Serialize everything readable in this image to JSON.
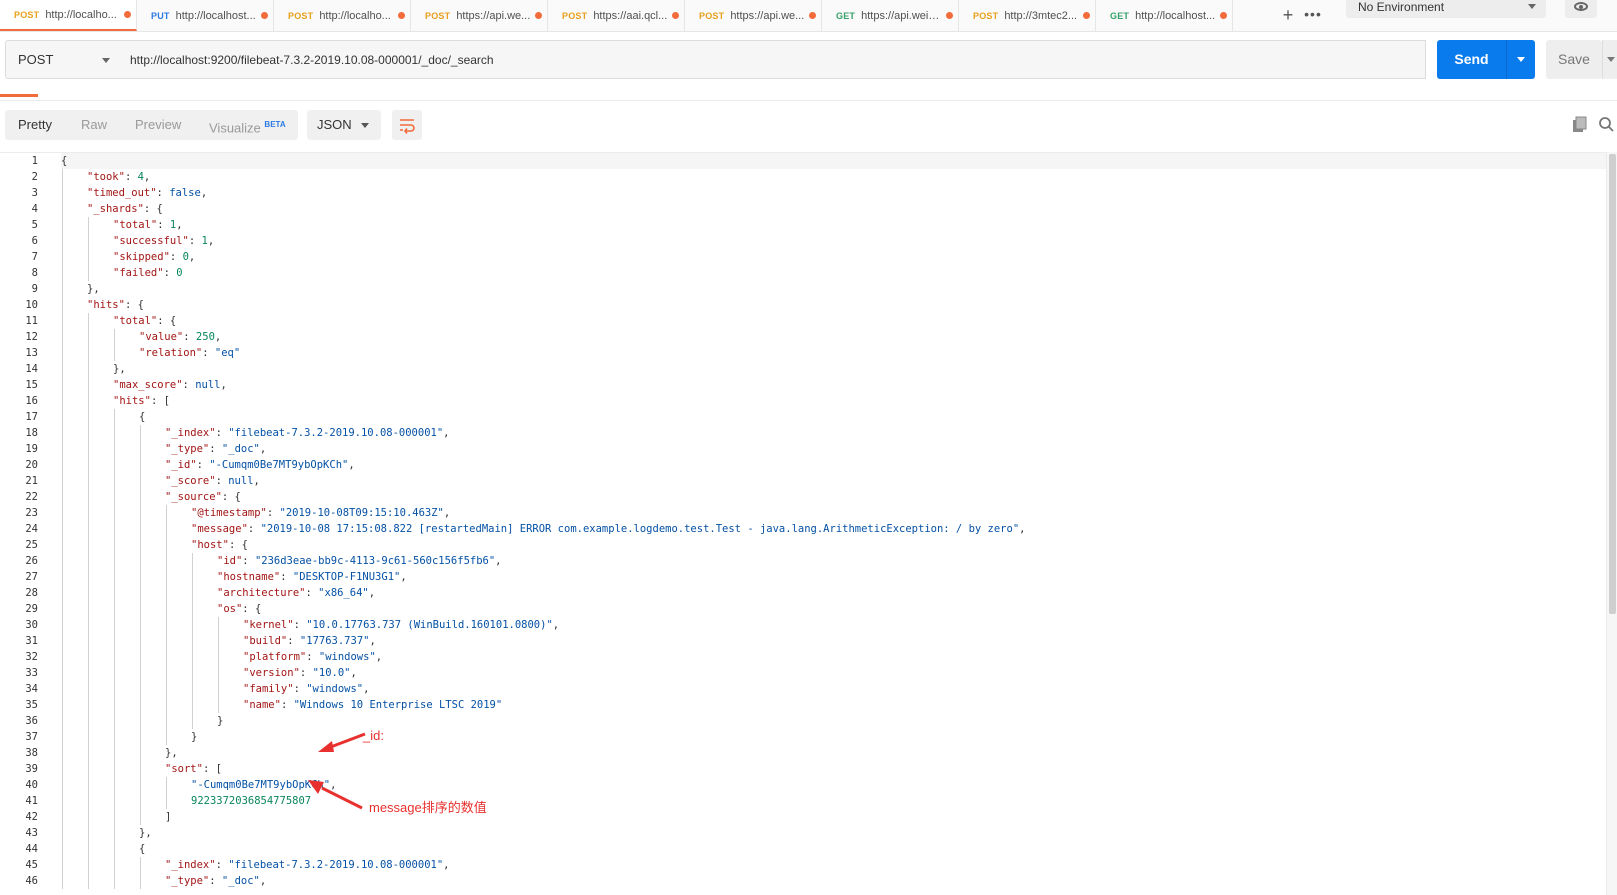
{
  "tabs": [
    {
      "method": "POST",
      "url": "http://localho..."
    },
    {
      "method": "PUT",
      "url": "http://localhost..."
    },
    {
      "method": "POST",
      "url": "http://localho..."
    },
    {
      "method": "POST",
      "url": "https://api.we..."
    },
    {
      "method": "POST",
      "url": "https://aai.qcl..."
    },
    {
      "method": "POST",
      "url": "https://api.we..."
    },
    {
      "method": "GET",
      "url": "https://api.weix..."
    },
    {
      "method": "POST",
      "url": "http://3mtec2..."
    },
    {
      "method": "GET",
      "url": "http://localhost..."
    }
  ],
  "environment": {
    "label": "No Environment"
  },
  "request": {
    "method": "POST",
    "url": "http://localhost:9200/filebeat-7.3.2-2019.10.08-000001/_doc/_search",
    "send_label": "Send",
    "save_label": "Save"
  },
  "response": {
    "view_tabs": [
      "Pretty",
      "Raw",
      "Preview",
      "Visualize"
    ],
    "beta_badge": "BETA",
    "format": "JSON"
  },
  "code_lines": [
    {
      "n": "1",
      "i": 0,
      "t": [
        [
          "p",
          "{"
        ]
      ]
    },
    {
      "n": "2",
      "i": 1,
      "t": [
        [
          "k",
          "\"took\""
        ],
        [
          "p",
          ": "
        ],
        [
          "n",
          "4"
        ],
        [
          "p",
          ","
        ]
      ]
    },
    {
      "n": "3",
      "i": 1,
      "t": [
        [
          "k",
          "\"timed_out\""
        ],
        [
          "p",
          ": "
        ],
        [
          "w",
          "false"
        ],
        [
          "p",
          ","
        ]
      ]
    },
    {
      "n": "4",
      "i": 1,
      "t": [
        [
          "k",
          "\"_shards\""
        ],
        [
          "p",
          ": {"
        ]
      ]
    },
    {
      "n": "5",
      "i": 2,
      "t": [
        [
          "k",
          "\"total\""
        ],
        [
          "p",
          ": "
        ],
        [
          "n",
          "1"
        ],
        [
          "p",
          ","
        ]
      ]
    },
    {
      "n": "6",
      "i": 2,
      "t": [
        [
          "k",
          "\"successful\""
        ],
        [
          "p",
          ": "
        ],
        [
          "n",
          "1"
        ],
        [
          "p",
          ","
        ]
      ]
    },
    {
      "n": "7",
      "i": 2,
      "t": [
        [
          "k",
          "\"skipped\""
        ],
        [
          "p",
          ": "
        ],
        [
          "n",
          "0"
        ],
        [
          "p",
          ","
        ]
      ]
    },
    {
      "n": "8",
      "i": 2,
      "t": [
        [
          "k",
          "\"failed\""
        ],
        [
          "p",
          ": "
        ],
        [
          "n",
          "0"
        ]
      ]
    },
    {
      "n": "9",
      "i": 1,
      "t": [
        [
          "p",
          "},"
        ]
      ]
    },
    {
      "n": "10",
      "i": 1,
      "t": [
        [
          "k",
          "\"hits\""
        ],
        [
          "p",
          ": {"
        ]
      ]
    },
    {
      "n": "11",
      "i": 2,
      "t": [
        [
          "k",
          "\"total\""
        ],
        [
          "p",
          ": {"
        ]
      ]
    },
    {
      "n": "12",
      "i": 3,
      "t": [
        [
          "k",
          "\"value\""
        ],
        [
          "p",
          ": "
        ],
        [
          "n",
          "250"
        ],
        [
          "p",
          ","
        ]
      ]
    },
    {
      "n": "13",
      "i": 3,
      "t": [
        [
          "k",
          "\"relation\""
        ],
        [
          "p",
          ": "
        ],
        [
          "s",
          "\"eq\""
        ]
      ]
    },
    {
      "n": "14",
      "i": 2,
      "t": [
        [
          "p",
          "},"
        ]
      ]
    },
    {
      "n": "15",
      "i": 2,
      "t": [
        [
          "k",
          "\"max_score\""
        ],
        [
          "p",
          ": "
        ],
        [
          "w",
          "null"
        ],
        [
          "p",
          ","
        ]
      ]
    },
    {
      "n": "16",
      "i": 2,
      "t": [
        [
          "k",
          "\"hits\""
        ],
        [
          "p",
          ": ["
        ]
      ]
    },
    {
      "n": "17",
      "i": 3,
      "t": [
        [
          "p",
          "{"
        ]
      ]
    },
    {
      "n": "18",
      "i": 4,
      "t": [
        [
          "k",
          "\"_index\""
        ],
        [
          "p",
          ": "
        ],
        [
          "s",
          "\"filebeat-7.3.2-2019.10.08-000001\""
        ],
        [
          "p",
          ","
        ]
      ]
    },
    {
      "n": "19",
      "i": 4,
      "t": [
        [
          "k",
          "\"_type\""
        ],
        [
          "p",
          ": "
        ],
        [
          "s",
          "\"_doc\""
        ],
        [
          "p",
          ","
        ]
      ]
    },
    {
      "n": "20",
      "i": 4,
      "t": [
        [
          "k",
          "\"_id\""
        ],
        [
          "p",
          ": "
        ],
        [
          "s",
          "\"-Cumqm0Be7MT9ybOpKCh\""
        ],
        [
          "p",
          ","
        ]
      ]
    },
    {
      "n": "21",
      "i": 4,
      "t": [
        [
          "k",
          "\"_score\""
        ],
        [
          "p",
          ": "
        ],
        [
          "w",
          "null"
        ],
        [
          "p",
          ","
        ]
      ]
    },
    {
      "n": "22",
      "i": 4,
      "t": [
        [
          "k",
          "\"_source\""
        ],
        [
          "p",
          ": {"
        ]
      ]
    },
    {
      "n": "23",
      "i": 5,
      "t": [
        [
          "k",
          "\"@timestamp\""
        ],
        [
          "p",
          ": "
        ],
        [
          "s",
          "\"2019-10-08T09:15:10.463Z\""
        ],
        [
          "p",
          ","
        ]
      ]
    },
    {
      "n": "24",
      "i": 5,
      "t": [
        [
          "k",
          "\"message\""
        ],
        [
          "p",
          ": "
        ],
        [
          "s",
          "\"2019-10-08 17:15:08.822 [restartedMain] ERROR com.example.logdemo.test.Test - java.lang.ArithmeticException: / by zero\""
        ],
        [
          "p",
          ","
        ]
      ]
    },
    {
      "n": "25",
      "i": 5,
      "t": [
        [
          "k",
          "\"host\""
        ],
        [
          "p",
          ": {"
        ]
      ]
    },
    {
      "n": "26",
      "i": 6,
      "t": [
        [
          "k",
          "\"id\""
        ],
        [
          "p",
          ": "
        ],
        [
          "s",
          "\"236d3eae-bb9c-4113-9c61-560c156f5fb6\""
        ],
        [
          "p",
          ","
        ]
      ]
    },
    {
      "n": "27",
      "i": 6,
      "t": [
        [
          "k",
          "\"hostname\""
        ],
        [
          "p",
          ": "
        ],
        [
          "s",
          "\"DESKTOP-F1NU3G1\""
        ],
        [
          "p",
          ","
        ]
      ]
    },
    {
      "n": "28",
      "i": 6,
      "t": [
        [
          "k",
          "\"architecture\""
        ],
        [
          "p",
          ": "
        ],
        [
          "s",
          "\"x86_64\""
        ],
        [
          "p",
          ","
        ]
      ]
    },
    {
      "n": "29",
      "i": 6,
      "t": [
        [
          "k",
          "\"os\""
        ],
        [
          "p",
          ": {"
        ]
      ]
    },
    {
      "n": "30",
      "i": 7,
      "t": [
        [
          "k",
          "\"kernel\""
        ],
        [
          "p",
          ": "
        ],
        [
          "s",
          "\"10.0.17763.737 (WinBuild.160101.0800)\""
        ],
        [
          "p",
          ","
        ]
      ]
    },
    {
      "n": "31",
      "i": 7,
      "t": [
        [
          "k",
          "\"build\""
        ],
        [
          "p",
          ": "
        ],
        [
          "s",
          "\"17763.737\""
        ],
        [
          "p",
          ","
        ]
      ]
    },
    {
      "n": "32",
      "i": 7,
      "t": [
        [
          "k",
          "\"platform\""
        ],
        [
          "p",
          ": "
        ],
        [
          "s",
          "\"windows\""
        ],
        [
          "p",
          ","
        ]
      ]
    },
    {
      "n": "33",
      "i": 7,
      "t": [
        [
          "k",
          "\"version\""
        ],
        [
          "p",
          ": "
        ],
        [
          "s",
          "\"10.0\""
        ],
        [
          "p",
          ","
        ]
      ]
    },
    {
      "n": "34",
      "i": 7,
      "t": [
        [
          "k",
          "\"family\""
        ],
        [
          "p",
          ": "
        ],
        [
          "s",
          "\"windows\""
        ],
        [
          "p",
          ","
        ]
      ]
    },
    {
      "n": "35",
      "i": 7,
      "t": [
        [
          "k",
          "\"name\""
        ],
        [
          "p",
          ": "
        ],
        [
          "s",
          "\"Windows 10 Enterprise LTSC 2019\""
        ]
      ]
    },
    {
      "n": "36",
      "i": 6,
      "t": [
        [
          "p",
          "}"
        ]
      ]
    },
    {
      "n": "37",
      "i": 5,
      "t": [
        [
          "p",
          "}"
        ]
      ]
    },
    {
      "n": "38",
      "i": 4,
      "t": [
        [
          "p",
          "},"
        ]
      ]
    },
    {
      "n": "39",
      "i": 4,
      "t": [
        [
          "k",
          "\"sort\""
        ],
        [
          "p",
          ": ["
        ]
      ]
    },
    {
      "n": "40",
      "i": 5,
      "t": [
        [
          "s",
          "\"-Cumqm0Be7MT9ybOpKCh\""
        ],
        [
          "p",
          ","
        ]
      ]
    },
    {
      "n": "41",
      "i": 5,
      "t": [
        [
          "n",
          "9223372036854775807"
        ]
      ]
    },
    {
      "n": "42",
      "i": 4,
      "t": [
        [
          "p",
          "]"
        ]
      ]
    },
    {
      "n": "43",
      "i": 3,
      "t": [
        [
          "p",
          "},"
        ]
      ]
    },
    {
      "n": "44",
      "i": 3,
      "t": [
        [
          "p",
          "{"
        ]
      ]
    },
    {
      "n": "45",
      "i": 4,
      "t": [
        [
          "k",
          "\"_index\""
        ],
        [
          "p",
          ": "
        ],
        [
          "s",
          "\"filebeat-7.3.2-2019.10.08-000001\""
        ],
        [
          "p",
          ","
        ]
      ]
    },
    {
      "n": "46",
      "i": 4,
      "t": [
        [
          "k",
          "\"_type\""
        ],
        [
          "p",
          ": "
        ],
        [
          "s",
          "\"_doc\""
        ],
        [
          "p",
          ","
        ]
      ]
    }
  ],
  "annotations": {
    "id_label": "_id:",
    "message_label": "message排序的数值",
    "color": "#e8312e"
  },
  "colors": {
    "accent": "#f26b3a",
    "send": "#097bed",
    "post": "#e8a01c",
    "put": "#2a7ae2",
    "get": "#35a06b"
  },
  "icons": [
    "plus-icon",
    "more-icon",
    "eye-icon",
    "wrap-icon",
    "copy-icon",
    "search-icon"
  ]
}
